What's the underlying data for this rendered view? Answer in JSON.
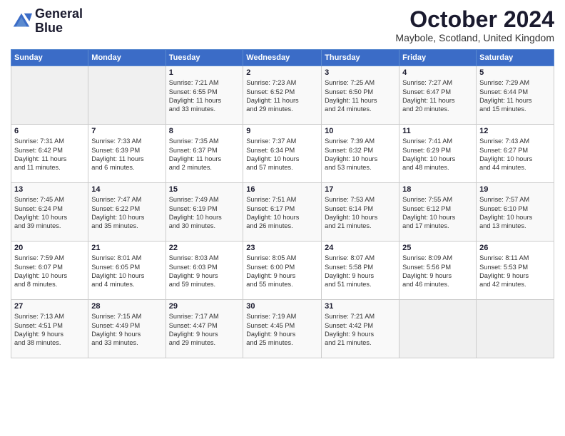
{
  "logo": {
    "line1": "General",
    "line2": "Blue"
  },
  "title": "October 2024",
  "location": "Maybole, Scotland, United Kingdom",
  "days_header": [
    "Sunday",
    "Monday",
    "Tuesday",
    "Wednesday",
    "Thursday",
    "Friday",
    "Saturday"
  ],
  "weeks": [
    [
      {
        "day": "",
        "content": ""
      },
      {
        "day": "",
        "content": ""
      },
      {
        "day": "1",
        "content": "Sunrise: 7:21 AM\nSunset: 6:55 PM\nDaylight: 11 hours\nand 33 minutes."
      },
      {
        "day": "2",
        "content": "Sunrise: 7:23 AM\nSunset: 6:52 PM\nDaylight: 11 hours\nand 29 minutes."
      },
      {
        "day": "3",
        "content": "Sunrise: 7:25 AM\nSunset: 6:50 PM\nDaylight: 11 hours\nand 24 minutes."
      },
      {
        "day": "4",
        "content": "Sunrise: 7:27 AM\nSunset: 6:47 PM\nDaylight: 11 hours\nand 20 minutes."
      },
      {
        "day": "5",
        "content": "Sunrise: 7:29 AM\nSunset: 6:44 PM\nDaylight: 11 hours\nand 15 minutes."
      }
    ],
    [
      {
        "day": "6",
        "content": "Sunrise: 7:31 AM\nSunset: 6:42 PM\nDaylight: 11 hours\nand 11 minutes."
      },
      {
        "day": "7",
        "content": "Sunrise: 7:33 AM\nSunset: 6:39 PM\nDaylight: 11 hours\nand 6 minutes."
      },
      {
        "day": "8",
        "content": "Sunrise: 7:35 AM\nSunset: 6:37 PM\nDaylight: 11 hours\nand 2 minutes."
      },
      {
        "day": "9",
        "content": "Sunrise: 7:37 AM\nSunset: 6:34 PM\nDaylight: 10 hours\nand 57 minutes."
      },
      {
        "day": "10",
        "content": "Sunrise: 7:39 AM\nSunset: 6:32 PM\nDaylight: 10 hours\nand 53 minutes."
      },
      {
        "day": "11",
        "content": "Sunrise: 7:41 AM\nSunset: 6:29 PM\nDaylight: 10 hours\nand 48 minutes."
      },
      {
        "day": "12",
        "content": "Sunrise: 7:43 AM\nSunset: 6:27 PM\nDaylight: 10 hours\nand 44 minutes."
      }
    ],
    [
      {
        "day": "13",
        "content": "Sunrise: 7:45 AM\nSunset: 6:24 PM\nDaylight: 10 hours\nand 39 minutes."
      },
      {
        "day": "14",
        "content": "Sunrise: 7:47 AM\nSunset: 6:22 PM\nDaylight: 10 hours\nand 35 minutes."
      },
      {
        "day": "15",
        "content": "Sunrise: 7:49 AM\nSunset: 6:19 PM\nDaylight: 10 hours\nand 30 minutes."
      },
      {
        "day": "16",
        "content": "Sunrise: 7:51 AM\nSunset: 6:17 PM\nDaylight: 10 hours\nand 26 minutes."
      },
      {
        "day": "17",
        "content": "Sunrise: 7:53 AM\nSunset: 6:14 PM\nDaylight: 10 hours\nand 21 minutes."
      },
      {
        "day": "18",
        "content": "Sunrise: 7:55 AM\nSunset: 6:12 PM\nDaylight: 10 hours\nand 17 minutes."
      },
      {
        "day": "19",
        "content": "Sunrise: 7:57 AM\nSunset: 6:10 PM\nDaylight: 10 hours\nand 13 minutes."
      }
    ],
    [
      {
        "day": "20",
        "content": "Sunrise: 7:59 AM\nSunset: 6:07 PM\nDaylight: 10 hours\nand 8 minutes."
      },
      {
        "day": "21",
        "content": "Sunrise: 8:01 AM\nSunset: 6:05 PM\nDaylight: 10 hours\nand 4 minutes."
      },
      {
        "day": "22",
        "content": "Sunrise: 8:03 AM\nSunset: 6:03 PM\nDaylight: 9 hours\nand 59 minutes."
      },
      {
        "day": "23",
        "content": "Sunrise: 8:05 AM\nSunset: 6:00 PM\nDaylight: 9 hours\nand 55 minutes."
      },
      {
        "day": "24",
        "content": "Sunrise: 8:07 AM\nSunset: 5:58 PM\nDaylight: 9 hours\nand 51 minutes."
      },
      {
        "day": "25",
        "content": "Sunrise: 8:09 AM\nSunset: 5:56 PM\nDaylight: 9 hours\nand 46 minutes."
      },
      {
        "day": "26",
        "content": "Sunrise: 8:11 AM\nSunset: 5:53 PM\nDaylight: 9 hours\nand 42 minutes."
      }
    ],
    [
      {
        "day": "27",
        "content": "Sunrise: 7:13 AM\nSunset: 4:51 PM\nDaylight: 9 hours\nand 38 minutes."
      },
      {
        "day": "28",
        "content": "Sunrise: 7:15 AM\nSunset: 4:49 PM\nDaylight: 9 hours\nand 33 minutes."
      },
      {
        "day": "29",
        "content": "Sunrise: 7:17 AM\nSunset: 4:47 PM\nDaylight: 9 hours\nand 29 minutes."
      },
      {
        "day": "30",
        "content": "Sunrise: 7:19 AM\nSunset: 4:45 PM\nDaylight: 9 hours\nand 25 minutes."
      },
      {
        "day": "31",
        "content": "Sunrise: 7:21 AM\nSunset: 4:42 PM\nDaylight: 9 hours\nand 21 minutes."
      },
      {
        "day": "",
        "content": ""
      },
      {
        "day": "",
        "content": ""
      }
    ]
  ]
}
